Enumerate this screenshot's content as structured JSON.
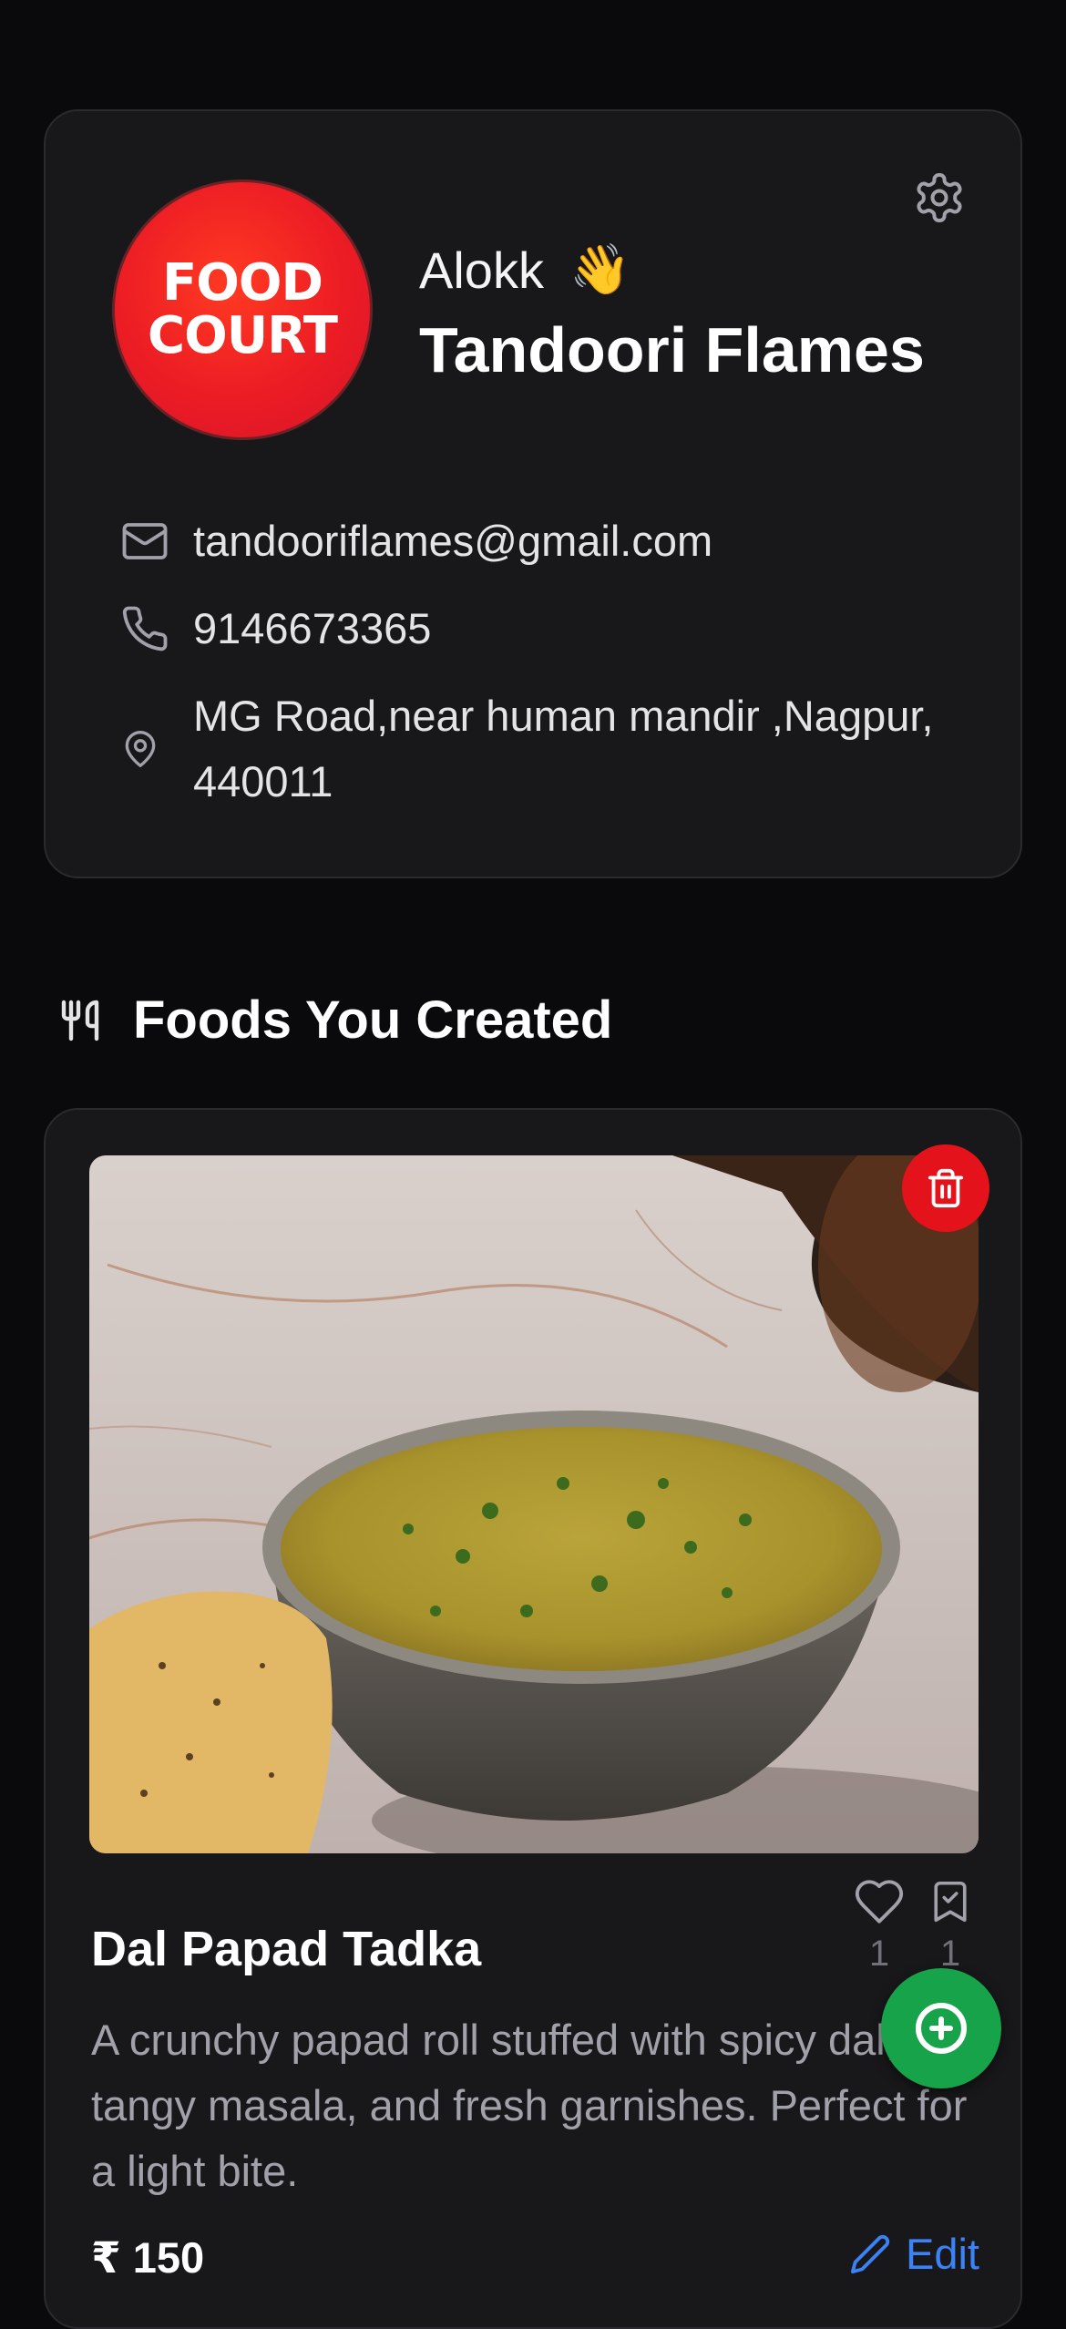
{
  "profile": {
    "logo_line1": "FOOD",
    "logo_line2": "COURT",
    "greeting_name": "Alokk",
    "greeting_emoji": "👋",
    "restaurant_name": "Tandoori Flames",
    "email": "tandooriflames@gmail.com",
    "phone": "9146673365",
    "address": "MG Road,near human mandir ,Nagpur, 440011"
  },
  "section": {
    "title": "Foods You Created"
  },
  "food": {
    "title": "Dal Papad Tadka",
    "description": "A crunchy papad roll stuffed with spicy dal, tangy masala, and fresh garnishes. Perfect for a light bite.",
    "price": "₹ 150",
    "likes": "1",
    "saves": "1",
    "edit_label": "Edit"
  },
  "icons": {
    "settings": "gear-icon",
    "email": "mail-icon",
    "phone": "phone-icon",
    "location": "map-pin-icon",
    "section": "utensils-icon",
    "delete": "trash-icon",
    "like": "heart-icon",
    "save": "bookmark-check-icon",
    "edit": "pencil-icon",
    "add": "plus-circle-icon"
  },
  "colors": {
    "background": "#0a0a0c",
    "card": "#18181b",
    "brand_red": "#ec1c24",
    "delete": "#e3121b",
    "fab": "#16a34a",
    "edit_link": "#3b82f6"
  }
}
